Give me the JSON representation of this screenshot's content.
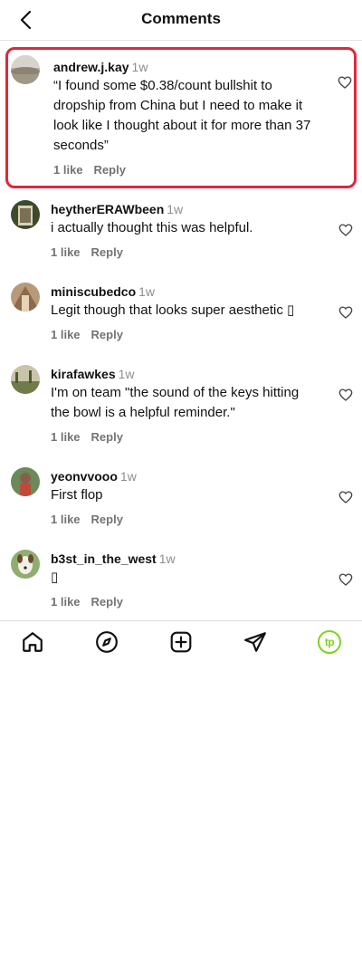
{
  "header": {
    "title": "Comments",
    "back_icon": "chevron-left-icon"
  },
  "comments": [
    {
      "username": "andrew.j.kay",
      "time": "1w",
      "text": "“I found some $0.38/count bullshit to dropship from China but I need to make it look like I thought about it for more than 37 seconds”",
      "likes": "1 like",
      "reply": "Reply",
      "highlighted": true
    },
    {
      "username": "heytherERAWbeen",
      "time": "1w",
      "text": "i actually thought this was helpful.",
      "likes": "1 like",
      "reply": "Reply"
    },
    {
      "username": "miniscubedco",
      "time": "1w",
      "text": "Legit though that looks super aesthetic ▯",
      "likes": "1 like",
      "reply": "Reply"
    },
    {
      "username": "kirafawkes",
      "time": "1w",
      "text": "I'm on team \"the sound of the keys hitting the bowl is a helpful reminder.\"",
      "likes": "1 like",
      "reply": "Reply"
    },
    {
      "username": "yeonvvooo",
      "time": "1w",
      "text": "First flop",
      "likes": "1 like",
      "reply": "Reply"
    },
    {
      "username": "b3st_in_the_west",
      "time": "1w",
      "text": "▯",
      "likes": "1 like",
      "reply": "Reply"
    }
  ],
  "bottom_nav": {
    "items": [
      "home-icon",
      "explore-icon",
      "create-icon",
      "send-icon",
      "profile-icon"
    ],
    "profile_initials": "tp",
    "profile_color": "#7ed321"
  },
  "colors": {
    "highlight_border": "#e0283a",
    "secondary_text": "#737373"
  }
}
